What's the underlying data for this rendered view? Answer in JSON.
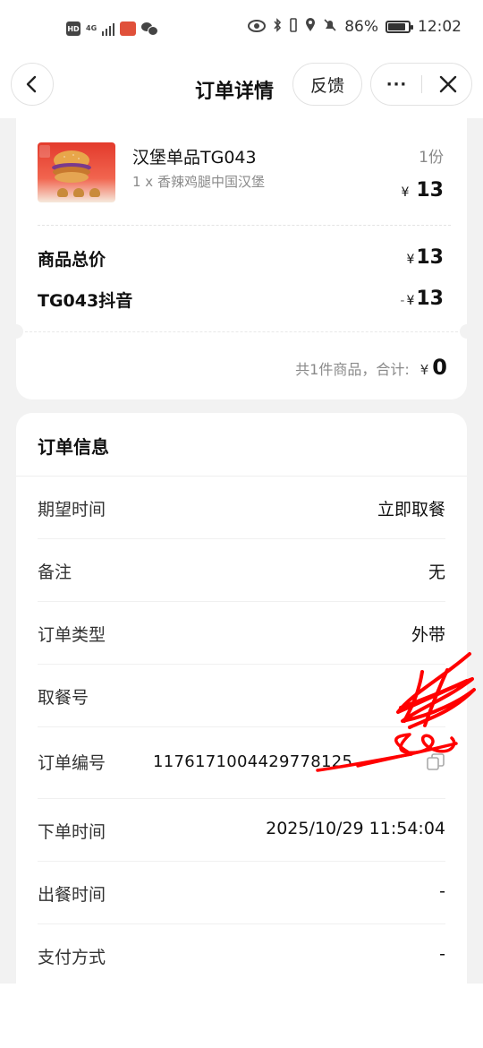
{
  "status_bar": {
    "hd": "HD",
    "network": "4G",
    "battery_percent": "86%",
    "battery_level": 0.86,
    "time": "12:02",
    "icons": [
      "eye-icon",
      "bluetooth-icon",
      "vibrate-icon",
      "location-icon",
      "mute-bell-icon"
    ]
  },
  "nav": {
    "title": "订单详情",
    "feedback_label": "反馈",
    "more_label": "···"
  },
  "product": {
    "name": "汉堡单品TG043",
    "desc": "1 x 香辣鸡腿中国汉堡",
    "qty": "1份",
    "currency": "¥",
    "price": "13"
  },
  "summary": {
    "goods_total_label": "商品总价",
    "goods_total_value": "13",
    "discount_label": "TG043抖音",
    "discount_sign": "-",
    "discount_value": "13",
    "total_prefix": "共1件商品，合计:",
    "total_amount": "0"
  },
  "order_info": {
    "title": "订单信息",
    "rows": [
      {
        "label": "期望时间",
        "value": "立即取餐"
      },
      {
        "label": "备注",
        "value": "无"
      },
      {
        "label": "订单类型",
        "value": "外带"
      },
      {
        "label": "取餐号",
        "value": ""
      },
      {
        "label": "订单编号",
        "value": "1176171004429778125"
      },
      {
        "label": "下单时间",
        "value": "2025/10/29 11:54:04"
      },
      {
        "label": "出餐时间",
        "value": "-"
      },
      {
        "label": "支付方式",
        "value": "-"
      }
    ]
  },
  "colors": {
    "brand_red": "#e33a2c",
    "scribble_red": "#ff0000",
    "background": "#f2f2f2"
  }
}
